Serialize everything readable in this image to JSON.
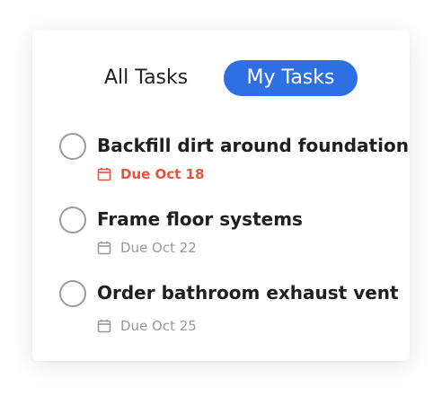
{
  "tabs": {
    "all_label": "All Tasks",
    "my_label": "My Tasks",
    "active": "My Tasks"
  },
  "colors": {
    "accent": "#2f6fe4",
    "overdue": "#e5533d",
    "muted": "#9a9a9a"
  },
  "tasks": [
    {
      "title": "Backfill dirt around foundation",
      "due": "Due Oct 18",
      "overdue": true
    },
    {
      "title": "Frame floor systems",
      "due": "Due Oct 22",
      "overdue": false
    },
    {
      "title": "Order bathroom exhaust vent",
      "due": "Due Oct 25",
      "overdue": false
    }
  ]
}
